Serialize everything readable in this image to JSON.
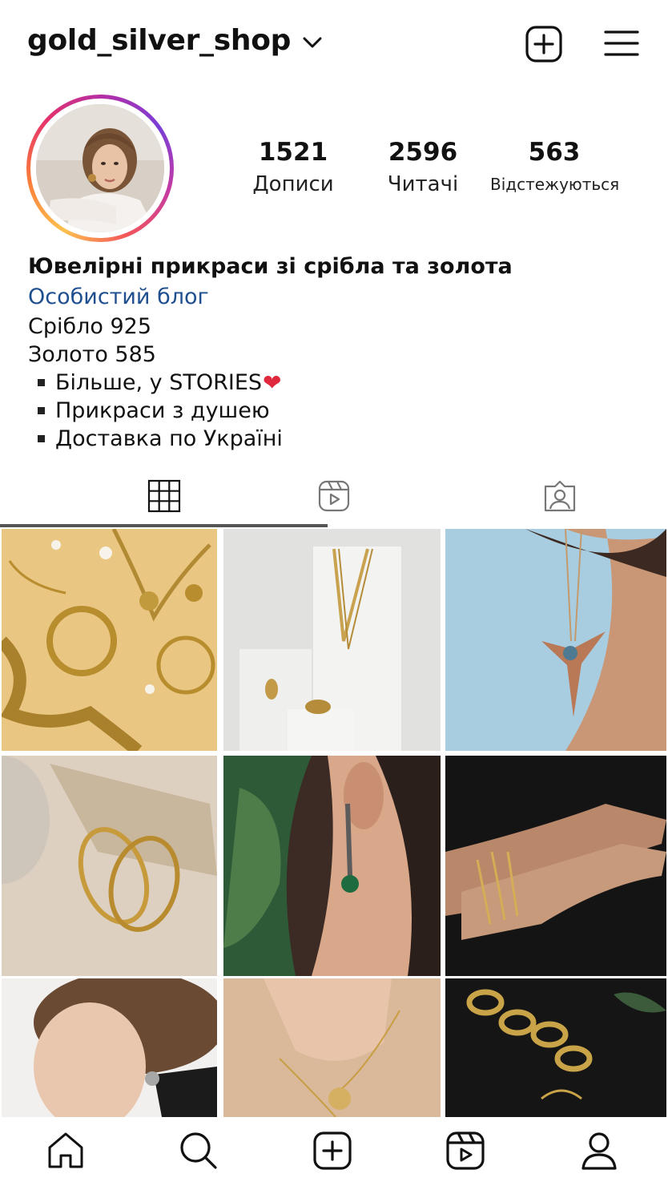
{
  "header": {
    "username": "gold_silver_shop",
    "dropdown_icon": "chevron-down-icon",
    "new_post_icon": "plus-square-icon",
    "menu_icon": "hamburger-menu-icon"
  },
  "profile": {
    "avatar_icon": "profile-photo",
    "stats": {
      "posts": {
        "value": "1521",
        "label": "Дописи"
      },
      "followers": {
        "value": "2596",
        "label": "Читачі"
      },
      "following": {
        "value": "563",
        "label": "Відстежуються"
      }
    }
  },
  "bio": {
    "title": "Ювелірні прикраси зі срібла та золота",
    "category": "Особистий блог",
    "lines": [
      "Срібло 925",
      "Золото 585"
    ],
    "bullets": [
      "Більше, у STORIES",
      "Прикраси з душею",
      "Доставка по Україні"
    ],
    "heart_emoji": "❤",
    "category_color": "#1f4f8f"
  },
  "tabs": [
    {
      "name": "grid",
      "icon": "grid-icon",
      "active": true
    },
    {
      "name": "reels",
      "icon": "reels-icon",
      "active": false
    },
    {
      "name": "tagged",
      "icon": "tagged-user-icon",
      "active": false
    }
  ],
  "posts": [
    "gold-chains-flatlay",
    "gold-necklace-on-stand",
    "hummingbird-pendant",
    "gold-hoop-earrings",
    "emerald-drop-earring",
    "gold-bracelets-on-wrists",
    "woman-with-earring",
    "hand-chain-bracelet",
    "gold-chain-on-leaves"
  ],
  "bottom_nav": [
    "home-icon",
    "search-icon",
    "add-post-icon",
    "reels-icon",
    "profile-icon"
  ]
}
